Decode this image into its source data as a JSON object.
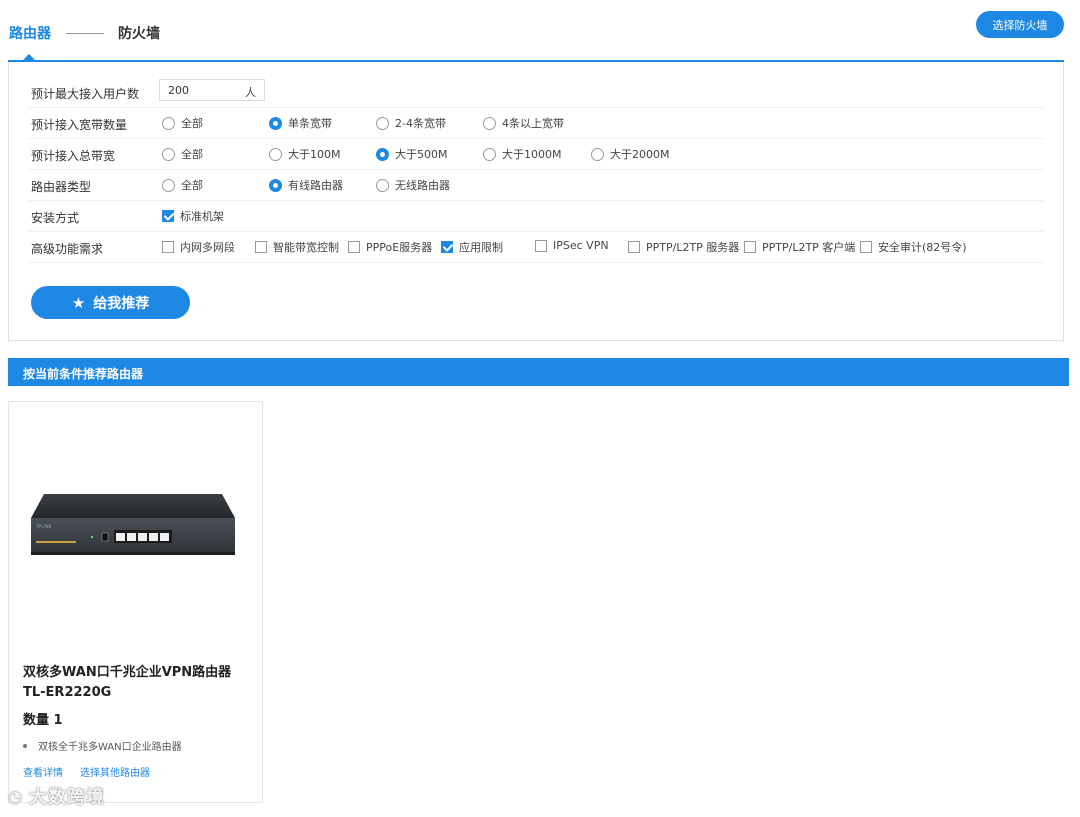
{
  "tabs": {
    "router": "路由器",
    "firewall": "防火墙"
  },
  "select_firewall_button": "选择防火墙",
  "filters": {
    "users": {
      "label": "预计最大接入用户数",
      "value": "200",
      "unit": "人"
    },
    "bandwidth_lines": {
      "label": "预计接入宽带数量",
      "options": [
        {
          "label": "全部",
          "selected": false
        },
        {
          "label": "单条宽带",
          "selected": true
        },
        {
          "label": "2-4条宽带",
          "selected": false
        },
        {
          "label": "4条以上宽带",
          "selected": false
        }
      ]
    },
    "total_bandwidth": {
      "label": "预计接入总带宽",
      "options": [
        {
          "label": "全部",
          "selected": false
        },
        {
          "label": "大于100M",
          "selected": false
        },
        {
          "label": "大于500M",
          "selected": true
        },
        {
          "label": "大于1000M",
          "selected": false
        },
        {
          "label": "大于2000M",
          "selected": false
        }
      ]
    },
    "router_type": {
      "label": "路由器类型",
      "options": [
        {
          "label": "全部",
          "selected": false
        },
        {
          "label": "有线路由器",
          "selected": true
        },
        {
          "label": "无线路由器",
          "selected": false
        }
      ]
    },
    "install": {
      "label": "安装方式",
      "options": [
        {
          "label": "标准机架",
          "checked": true
        }
      ]
    },
    "advanced": {
      "label": "高级功能需求",
      "options": [
        {
          "label": "内网多网段",
          "checked": false
        },
        {
          "label": "智能带宽控制",
          "checked": false
        },
        {
          "label": "PPPoE服务器",
          "checked": false
        },
        {
          "label": "应用限制",
          "checked": true
        },
        {
          "label": "IPSec VPN",
          "checked": false
        },
        {
          "label": "PPTP/L2TP 服务器",
          "checked": false
        },
        {
          "label": "PPTP/L2TP 客户端",
          "checked": false
        },
        {
          "label": "安全审计(82号令)",
          "checked": false
        }
      ]
    }
  },
  "recommend_button": "给我推荐",
  "results_title": "按当前条件推荐路由器",
  "product": {
    "name": "双核多WAN口千兆企业VPN路由器",
    "model": "TL-ER2220G",
    "quantity": "数量 1",
    "feature": "双核全千兆多WAN口企业路由器",
    "details_link": "查看详情",
    "other_link": "选择其他路由器",
    "brand_label": "TP-LINK"
  },
  "watermark": "大数跨境",
  "colors": {
    "accent": "#1e88e5"
  }
}
